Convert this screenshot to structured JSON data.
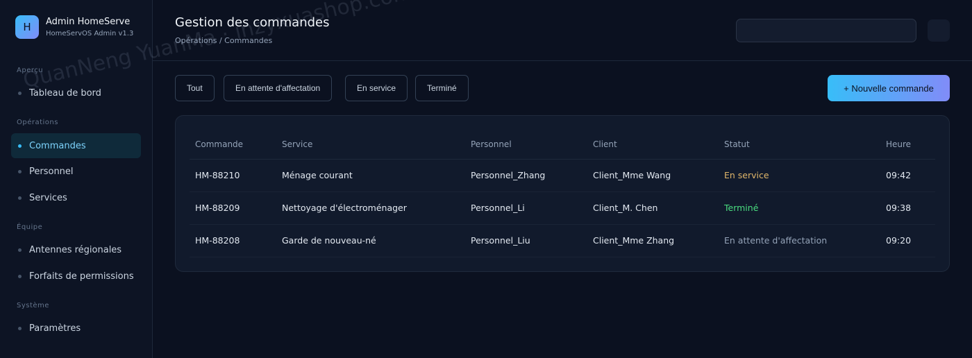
{
  "brand": {
    "logo_letter": "H",
    "name": "Admin HomeServe",
    "subtitle": "HomeServOS Admin v1.3"
  },
  "sidebar": {
    "sections": [
      {
        "title": "Aperçu",
        "items": [
          {
            "label": "Tableau de bord"
          }
        ]
      },
      {
        "title": "Opérations",
        "items": [
          {
            "label": "Commandes",
            "active": true
          },
          {
            "label": "Personnel"
          },
          {
            "label": "Services"
          }
        ]
      },
      {
        "title": "Équipe",
        "items": [
          {
            "label": "Antennes régionales"
          },
          {
            "label": "Forfaits de permissions"
          }
        ]
      },
      {
        "title": "Système",
        "items": [
          {
            "label": "Paramètres"
          }
        ]
      }
    ]
  },
  "header": {
    "title": "Gestion des commandes",
    "breadcrumb": "Opérations / Commandes",
    "search_value": ""
  },
  "filters": [
    "Tout",
    "En attente d'affectation",
    "En service",
    "Terminé"
  ],
  "new_order_label": "+ Nouvelle commande",
  "table": {
    "columns": [
      "Commande",
      "Service",
      "Personnel",
      "Client",
      "Statut",
      "Heure"
    ],
    "rows": [
      {
        "id": "HM-88210",
        "service": "Ménage courant",
        "staff": "Personnel_Zhang",
        "client": "Client_Mme Wang",
        "status": "En service",
        "time": "09:42"
      },
      {
        "id": "HM-88209",
        "service": "Nettoyage d'électroménager",
        "staff": "Personnel_Li",
        "client": "Client_M. Chen",
        "status": "Terminé",
        "time": "09:38"
      },
      {
        "id": "HM-88208",
        "service": "Garde de nouveau-né",
        "staff": "Personnel_Liu",
        "client": "Client_Mme Zhang",
        "status": "En attente d'affectation",
        "time": "09:20"
      }
    ]
  },
  "status_colors": {
    "En service": "#e0b66a",
    "Terminé": "#4ade80",
    "En attente d'affectation": "#94a3b8"
  },
  "accent_color": "#38bdf8",
  "watermark": "QuanNeng YuanMa · inzyxuashop.com"
}
